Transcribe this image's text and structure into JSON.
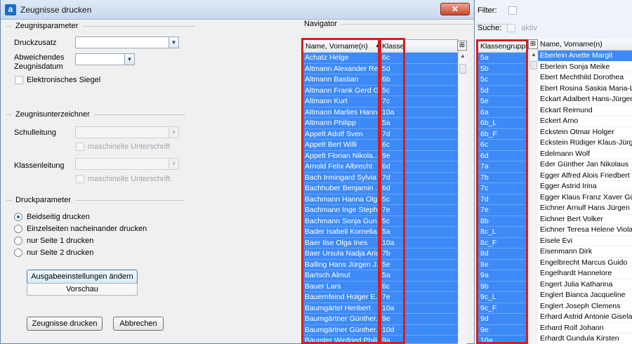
{
  "background": {
    "filter_label": "Filter:",
    "search_label": "Suche:",
    "search_active_label": "aktiv",
    "group_header": "Klassengruppe",
    "groups": [
      "5a",
      "5b",
      "5c",
      "5d",
      "5e",
      "6a",
      "6b_L",
      "6b_F",
      "6c",
      "6d",
      "7a",
      "7b",
      "7c",
      "7d",
      "7e",
      "8b",
      "8c_L",
      "8c_F",
      "8d",
      "8e",
      "9a",
      "9b",
      "9c_L",
      "9c_F",
      "9d",
      "9e",
      "10a"
    ],
    "names_header": "Name, Vorname(n)",
    "names": [
      "Eberlein Anette Margit",
      "Eberlein Sonja Meike",
      "Ebert Mechthild Dorothea",
      "Ebert Rosina Saskia Maria-Luise",
      "Eckart Adalbert Hans-Jürgen Otto",
      "Eckart Reimund",
      "Eckert Arno",
      "Eckstein Otmar Holger",
      "Eckstein Rüdiger Klaus-Jürgen",
      "Edelmann Wolf",
      "Eder Günther Jan Nikolaus",
      "Egger Alfred Alois Friedbert",
      "Egger Astrid Irina",
      "Egger Klaus Franz Xaver Günther",
      "Eichner Arnulf Hans Jürgen",
      "Eichner Bert Volker",
      "Eichner Teresa Helene Viola",
      "Eisele Evi",
      "Eisenmann Dirk",
      "Engelbrecht Marcus Guido",
      "Engelhardt Hannelore",
      "Engert Julia Katharina",
      "Englert Bianca Jacqueline",
      "Englert Joseph Clemens",
      "Erhard Astrid Antonie Gisela",
      "Erhard Rolf Johann",
      "Erhardt Gundula Kirsten"
    ]
  },
  "dialog": {
    "title": "Zeugnisse drucken",
    "close_symbol": "✕",
    "params": {
      "section_title": "Zeugnisparameter",
      "druckzusatz_label": "Druckzusatz",
      "datum_label_line1": "Abweichendes",
      "datum_label_line2": "Zeugnisdatum",
      "siegel_label": "Elektronisches Siegel"
    },
    "signers": {
      "section_title": "Zeugnisunterzeichner",
      "schulleitung_label": "Schulleitung",
      "klassenleitung_label": "Klassenleitung",
      "machine_sig_label": "maschinelle Unterschrift"
    },
    "print": {
      "section_title": "Druckparameter",
      "options": [
        "Beidseitig drucken",
        "Einzelseiten nacheinander drucken",
        "nur Seite 1 drucken",
        "nur Seite 2 drucken"
      ],
      "selected_index": 0,
      "output_settings_button": "Ausgabeeinstellungen ändern",
      "preview_label": "Vorschau"
    },
    "buttons": {
      "print": "Zeugnisse drucken",
      "cancel": "Abbrechen"
    },
    "navigator": {
      "title": "Navigator",
      "col_name": "Name, Vorname(n)",
      "col_class": "Klasse",
      "sort_symbol": "▲",
      "rows": [
        {
          "name": "Achatz Helge",
          "class": "6c"
        },
        {
          "name": "Altmann Alexander Re...",
          "class": "5d"
        },
        {
          "name": "Altmann Bastian",
          "class": "6b"
        },
        {
          "name": "Altmann Frank Gerd G...",
          "class": "5c"
        },
        {
          "name": "Altmann Kurt",
          "class": "7c"
        },
        {
          "name": "Altmann Marlies Hanna",
          "class": "10a"
        },
        {
          "name": "Altmann Philipp",
          "class": "5a"
        },
        {
          "name": "Appelt Adolf Sven",
          "class": "7d"
        },
        {
          "name": "Appelt Bert Willi",
          "class": "6c"
        },
        {
          "name": "Appelt Florian Nikola...",
          "class": "9e"
        },
        {
          "name": "Arnold Felix Albrecht",
          "class": "6d"
        },
        {
          "name": "Bach Irmingard Sylvia ...",
          "class": "7d"
        },
        {
          "name": "Bachhuber Benjamin ...",
          "class": "6d"
        },
        {
          "name": "Bachmann Hanna Olga",
          "class": "5c"
        },
        {
          "name": "Bachmann Inge Steph...",
          "class": "7e"
        },
        {
          "name": "Bachmann Sonja Gun...",
          "class": "5c"
        },
        {
          "name": "Bader Isabell Kornelia",
          "class": "5a"
        },
        {
          "name": "Baer Ilse Olga Ines",
          "class": "10a"
        },
        {
          "name": "Baer Ursula Nadja Aria...",
          "class": "7b"
        },
        {
          "name": "Balling Hans Jürgen J...",
          "class": "5e"
        },
        {
          "name": "Bartsch Almut",
          "class": "5a"
        },
        {
          "name": "Bauer Lars",
          "class": "6c"
        },
        {
          "name": "Bauernfeind Holger E...",
          "class": "7e"
        },
        {
          "name": "Baumgärtel Heribert",
          "class": "10a"
        },
        {
          "name": "Baumgärtner Günther...",
          "class": "9e"
        },
        {
          "name": "Baumgärtner Günther...",
          "class": "10d"
        },
        {
          "name": "Bäumler Winfried Phili...",
          "class": "9a"
        }
      ]
    }
  }
}
